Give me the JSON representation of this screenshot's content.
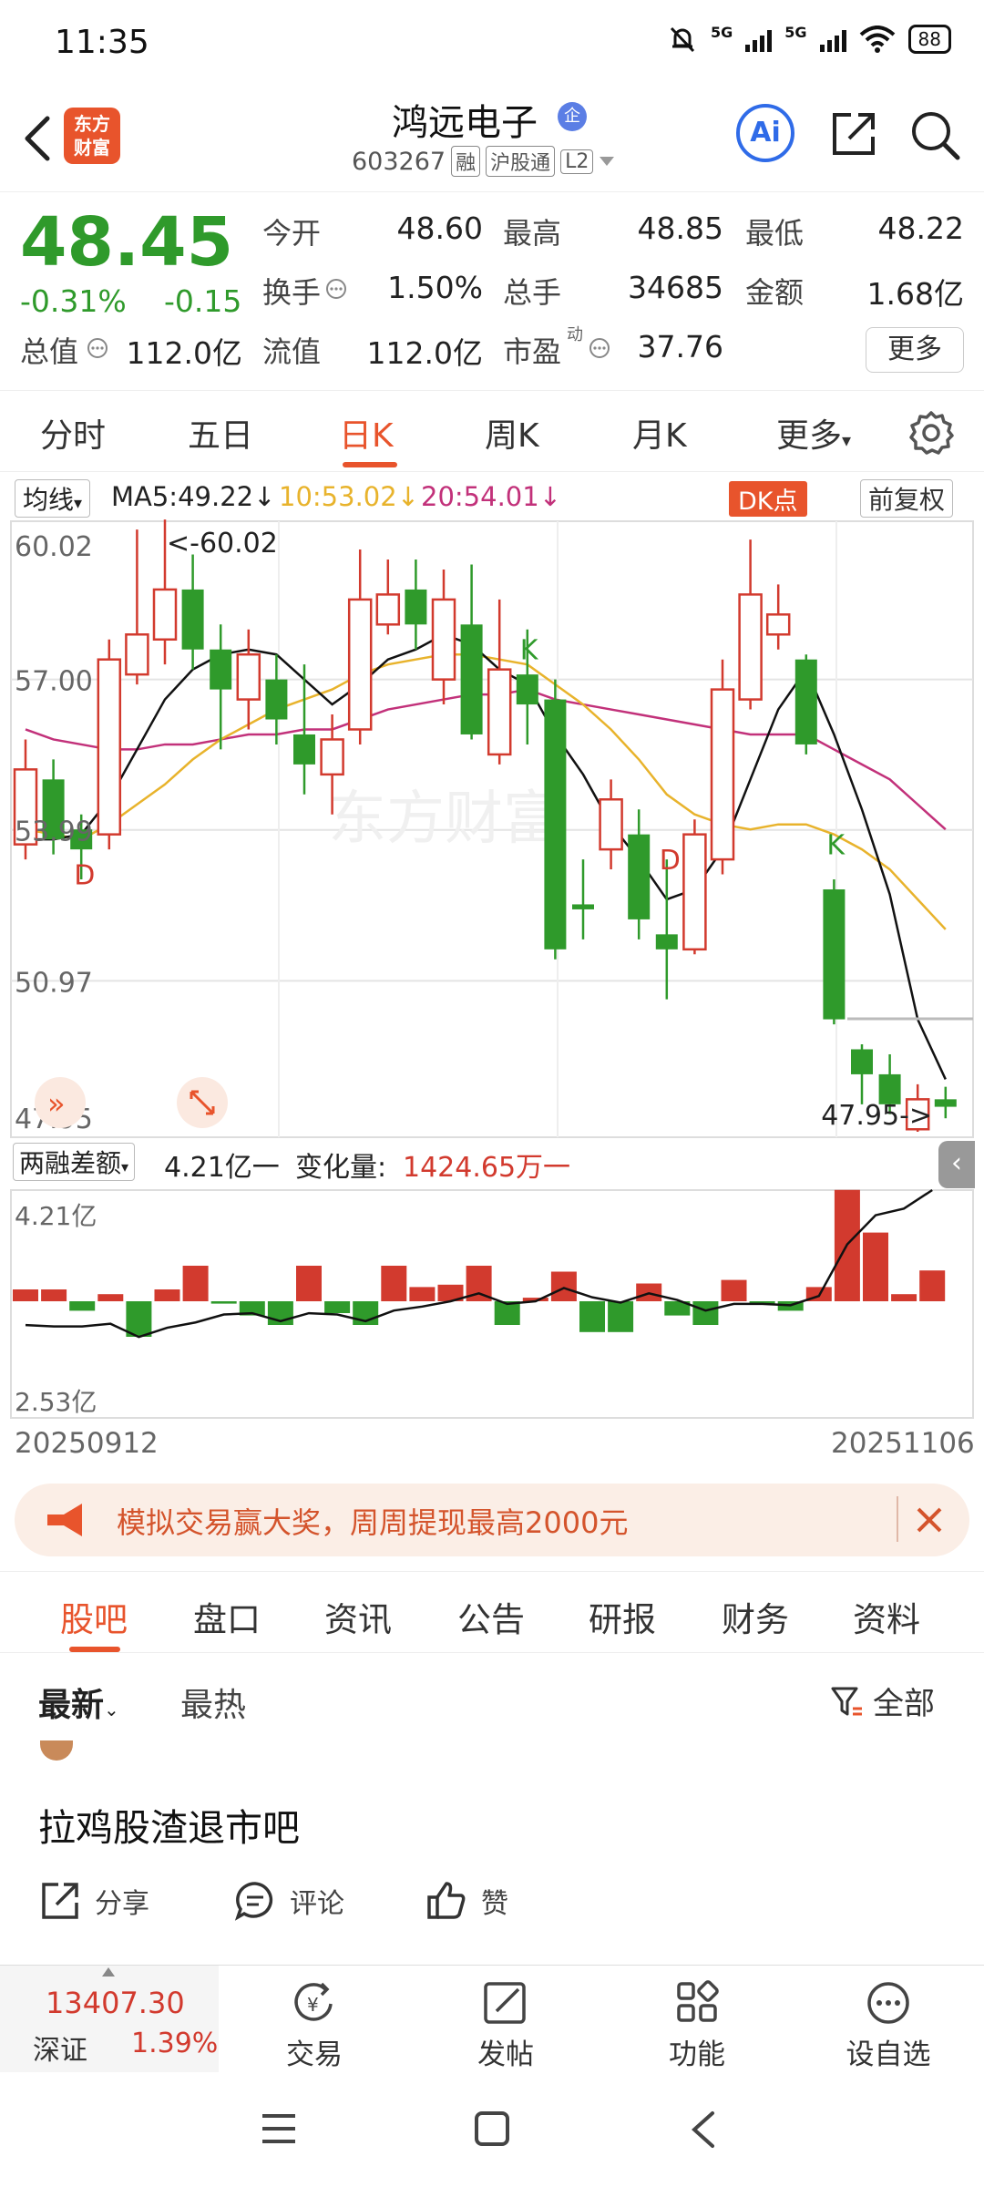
{
  "status": {
    "time": "11:35",
    "net1": "5G",
    "net2": "5G",
    "battery": "88"
  },
  "header": {
    "logo_line1": "东方",
    "logo_line2": "财富",
    "stock_name": "鸿远电子",
    "qi_badge": "企",
    "code": "603267",
    "tag_rong": "融",
    "tag_hgt": "沪股通",
    "tag_l2": "L2",
    "ai_label": "Ai"
  },
  "quote": {
    "price": "48.45",
    "change_pct": "-0.31%",
    "change": "-0.15",
    "open_label": "今开",
    "open": "48.60",
    "high_label": "最高",
    "high": "48.85",
    "low_label": "最低",
    "low": "48.22",
    "turnover_label": "换手",
    "turnover": "1.50%",
    "volume_label": "总手",
    "volume": "34685",
    "amount_label": "金额",
    "amount": "1.68亿",
    "mcap_label": "总值",
    "mcap": "112.0亿",
    "float_label": "流值",
    "float": "112.0亿",
    "pe_label": "市盈",
    "pe_sup": "动",
    "pe": "37.76",
    "more": "更多"
  },
  "chart_tabs": [
    "分时",
    "五日",
    "日K",
    "周K",
    "月K",
    "更多"
  ],
  "ma_row": {
    "select": "均线",
    "ma5": "MA5:49.22",
    "ma10": "10:53.02",
    "ma20": "20:54.01",
    "dk": "DK点",
    "fq": "前复权"
  },
  "colors": {
    "up": "#d23a2e",
    "down": "#2f9a2b",
    "accent": "#e8542c",
    "ma5": "#111111",
    "ma10": "#e8b32c",
    "ma20": "#c2317a"
  },
  "chart_data": [
    {
      "type": "candlestick",
      "y_ticks": [
        "60.02",
        "57.00",
        "53.99",
        "50.97",
        "47.95"
      ],
      "ylim": [
        47.95,
        60.02
      ],
      "max_label": "<-60.02",
      "min_label": "47.95->",
      "signals": [
        "D",
        "K",
        "D",
        "K"
      ],
      "candles": [
        {
          "o": 53.7,
          "c": 55.2,
          "h": 55.8,
          "l": 53.4
        },
        {
          "o": 55.0,
          "c": 53.8,
          "h": 55.4,
          "l": 53.5
        },
        {
          "o": 54.0,
          "c": 53.6,
          "h": 54.3,
          "l": 53.0
        },
        {
          "o": 53.9,
          "c": 57.4,
          "h": 57.8,
          "l": 53.6
        },
        {
          "o": 57.1,
          "c": 57.9,
          "h": 60.0,
          "l": 56.9
        },
        {
          "o": 57.8,
          "c": 58.8,
          "h": 60.2,
          "l": 57.3
        },
        {
          "o": 58.8,
          "c": 57.6,
          "h": 59.5,
          "l": 57.2
        },
        {
          "o": 57.6,
          "c": 56.8,
          "h": 58.1,
          "l": 55.6
        },
        {
          "o": 56.6,
          "c": 57.5,
          "h": 58.0,
          "l": 56.0
        },
        {
          "o": 57.0,
          "c": 56.2,
          "h": 57.5,
          "l": 55.7
        },
        {
          "o": 55.9,
          "c": 55.3,
          "h": 57.3,
          "l": 54.7
        },
        {
          "o": 55.1,
          "c": 55.8,
          "h": 56.3,
          "l": 54.3
        },
        {
          "o": 56.0,
          "c": 58.6,
          "h": 59.6,
          "l": 55.7
        },
        {
          "o": 58.1,
          "c": 58.7,
          "h": 59.4,
          "l": 57.9
        },
        {
          "o": 58.8,
          "c": 58.1,
          "h": 59.4,
          "l": 57.6
        },
        {
          "o": 57.0,
          "c": 58.6,
          "h": 59.2,
          "l": 56.5
        },
        {
          "o": 58.1,
          "c": 55.9,
          "h": 59.3,
          "l": 55.8
        },
        {
          "o": 55.5,
          "c": 57.2,
          "h": 58.6,
          "l": 55.3
        },
        {
          "o": 57.1,
          "c": 56.5,
          "h": 58.0,
          "l": 55.7
        },
        {
          "o": 56.6,
          "c": 51.6,
          "h": 57.0,
          "l": 51.4
        },
        {
          "o": 52.5,
          "c": 52.4,
          "h": 53.4,
          "l": 51.8
        },
        {
          "o": 53.6,
          "c": 54.6,
          "h": 55.0,
          "l": 53.2
        },
        {
          "o": 53.9,
          "c": 52.2,
          "h": 54.4,
          "l": 51.8
        },
        {
          "o": 51.9,
          "c": 51.6,
          "h": 53.4,
          "l": 50.6
        },
        {
          "o": 51.6,
          "c": 53.9,
          "h": 54.2,
          "l": 51.5
        },
        {
          "o": 53.4,
          "c": 56.8,
          "h": 57.4,
          "l": 53.1
        },
        {
          "o": 56.6,
          "c": 58.7,
          "h": 59.8,
          "l": 56.4
        },
        {
          "o": 57.9,
          "c": 58.3,
          "h": 58.9,
          "l": 57.6
        },
        {
          "o": 57.4,
          "c": 55.7,
          "h": 57.5,
          "l": 55.5
        },
        {
          "o": 52.8,
          "c": 50.2,
          "h": 53.0,
          "l": 50.1
        },
        {
          "o": 49.6,
          "c": 49.1,
          "h": 49.7,
          "l": 48.5
        },
        {
          "o": 49.1,
          "c": 48.5,
          "h": 49.5,
          "l": 48.3
        },
        {
          "o": 48.0,
          "c": 48.6,
          "h": 48.9,
          "l": 47.95
        },
        {
          "o": 48.6,
          "c": 48.45,
          "h": 48.85,
          "l": 48.22
        }
      ],
      "ma5": [
        53.8,
        53.8,
        53.9,
        54.6,
        55.6,
        56.6,
        57.2,
        57.5,
        57.6,
        57.5,
        57.0,
        56.5,
        56.9,
        57.4,
        57.6,
        57.9,
        57.7,
        57.2,
        56.9,
        55.9,
        55.1,
        54.1,
        53.4,
        52.6,
        52.8,
        53.6,
        55.0,
        56.4,
        57.2,
        55.9,
        54.4,
        52.7,
        50.2,
        49.0
      ],
      "ma10": [
        54.0,
        53.9,
        53.8,
        54.1,
        54.5,
        54.9,
        55.4,
        55.8,
        56.1,
        56.4,
        56.6,
        56.8,
        57.1,
        57.3,
        57.4,
        57.5,
        57.5,
        57.4,
        57.3,
        56.9,
        56.5,
        56.0,
        55.4,
        54.7,
        54.3,
        54.1,
        54.0,
        54.1,
        54.1,
        53.9,
        53.6,
        53.2,
        52.6,
        52.0
      ],
      "ma20": [
        56.0,
        55.8,
        55.7,
        55.6,
        55.6,
        55.7,
        55.7,
        55.8,
        55.9,
        55.9,
        56.0,
        56.0,
        56.2,
        56.4,
        56.5,
        56.6,
        56.7,
        56.7,
        56.8,
        56.6,
        56.5,
        56.4,
        56.3,
        56.2,
        56.1,
        56.0,
        55.9,
        55.9,
        55.9,
        55.6,
        55.3,
        55.0,
        54.5,
        54.0
      ]
    },
    {
      "type": "bar",
      "title": "两融差额",
      "value_label": "4.21亿一",
      "change_label": "变化量:",
      "change_value": "1424.65万一",
      "y_ticks": [
        "4.21亿",
        "2.53亿"
      ],
      "ylim": [
        2.53,
        4.21
      ],
      "x_start": "20250912",
      "x_end": "20251106",
      "bars": [
        0.1,
        0.1,
        -0.08,
        0.06,
        -0.3,
        0.1,
        0.3,
        -0.02,
        -0.12,
        -0.2,
        0.3,
        -0.1,
        -0.2,
        0.3,
        0.12,
        0.14,
        0.3,
        -0.2,
        0.03,
        0.25,
        -0.26,
        -0.26,
        0.15,
        -0.12,
        -0.2,
        0.18,
        -0.03,
        -0.08,
        0.12,
        0.94,
        0.58,
        0.06,
        0.26
      ],
      "line": [
        3.19,
        3.18,
        3.18,
        3.2,
        3.1,
        3.17,
        3.21,
        3.27,
        3.28,
        3.22,
        3.28,
        3.27,
        3.22,
        3.3,
        3.33,
        3.37,
        3.43,
        3.35,
        3.37,
        3.47,
        3.4,
        3.36,
        3.43,
        3.38,
        3.3,
        3.35,
        3.35,
        3.34,
        3.41,
        3.8,
        4.02,
        4.07,
        4.21
      ]
    }
  ],
  "promo": {
    "text": "模拟交易赢大奖，周周提现最高2000元"
  },
  "page_tabs": [
    "股吧",
    "盘口",
    "资讯",
    "公告",
    "研报",
    "财务",
    "资料"
  ],
  "sort": {
    "latest": "最新",
    "hot": "最热",
    "filter": "全部"
  },
  "post": {
    "title": "拉鸡股渣退市吧",
    "share": "分享",
    "comment": "评论",
    "like": "赞"
  },
  "bottom_nav": {
    "index_value": "13407.30",
    "index_name": "深证",
    "index_pct": "1.39%",
    "trade": "交易",
    "post": "发帖",
    "func": "功能",
    "watch": "设自选"
  }
}
